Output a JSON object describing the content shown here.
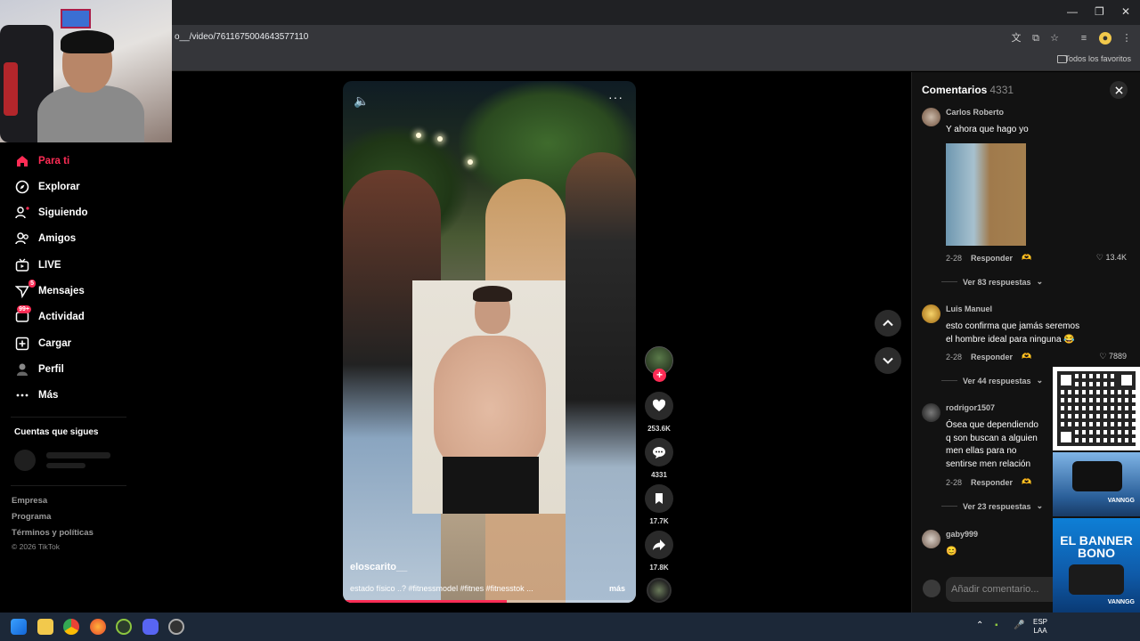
{
  "browser": {
    "url": "o__/video/7611675004643577110",
    "favorites_label": "Todos los favoritos"
  },
  "sidebar": {
    "items": [
      {
        "label": "Para ti",
        "icon": "home-icon",
        "active": true
      },
      {
        "label": "Explorar",
        "icon": "compass-icon"
      },
      {
        "label": "Siguiendo",
        "icon": "following-icon"
      },
      {
        "label": "Amigos",
        "icon": "friends-icon"
      },
      {
        "label": "LIVE",
        "icon": "live-icon"
      },
      {
        "label": "Mensajes",
        "icon": "messages-icon",
        "badge": "5"
      },
      {
        "label": "Actividad",
        "icon": "activity-icon",
        "badge": "99+"
      },
      {
        "label": "Cargar",
        "icon": "upload-icon"
      },
      {
        "label": "Perfil",
        "icon": "profile-icon"
      },
      {
        "label": "Más",
        "icon": "more-icon"
      }
    ],
    "following_title": "Cuentas que sigues",
    "footer": [
      "Empresa",
      "Programa",
      "Términos y políticas"
    ],
    "copyright": "© 2026 TikTok"
  },
  "video": {
    "username": "eloscarito__",
    "caption": "estado físico ..? #fitnessmodel #fitnes #fitnesstok ...",
    "more": "más",
    "progress": 0.56
  },
  "actions": {
    "likes": "253.6K",
    "comments": "4331",
    "saves": "17.7K",
    "shares": "17.8K"
  },
  "comments": {
    "title": "Comentarios",
    "count": "4331",
    "items": [
      {
        "user": "Carlos Roberto",
        "text": "Y ahora que hago yo",
        "date": "2-28",
        "reply": "Responder",
        "likes": "13.4K",
        "replies": "Ver 83 respuestas"
      },
      {
        "user": "Luis Manuel",
        "text": "esto confirma que jamás seremos el hombre ideal para ninguna 😂",
        "date": "2-28",
        "reply": "Responder",
        "likes": "7889",
        "replies": "Ver 44 respuestas"
      },
      {
        "user": "rodrigor1507",
        "text": "Ósea que dependiendo q son buscan a alguien men ellas para no sentirse men relación",
        "date": "2-28",
        "reply": "Responder",
        "likes": "",
        "replies": "Ver 23 respuestas"
      },
      {
        "user": "gaby999",
        "text": "😊",
        "date": "",
        "reply": "",
        "likes": "",
        "replies": ""
      }
    ],
    "add_placeholder": "Añadir comentario..."
  },
  "ads": {
    "banner_title": "EL BANNER BONO",
    "brand": "VANNGG"
  },
  "taskbar": {
    "lang_top": "ESP",
    "lang_bottom": "LAA"
  }
}
